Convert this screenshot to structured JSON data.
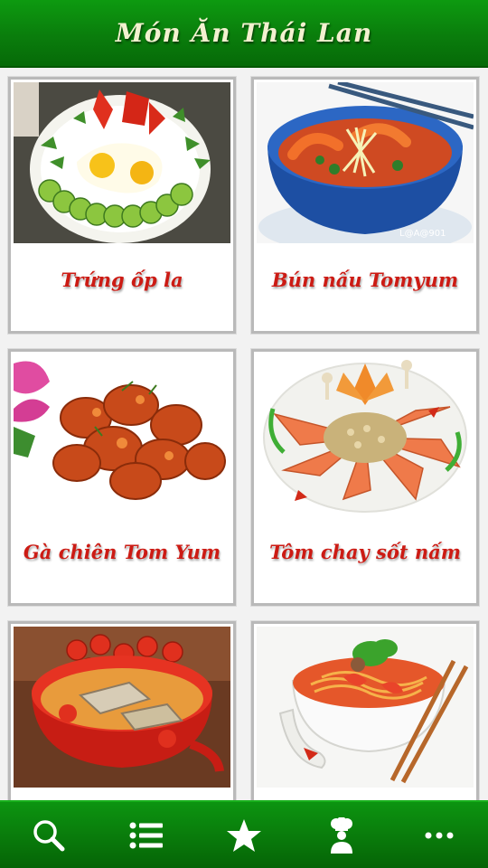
{
  "header": {
    "title": "Món Ăn Thái Lan"
  },
  "dishes": [
    {
      "name": "Trứng ốp la"
    },
    {
      "name": "Bún nấu Tomyum"
    },
    {
      "name": "Gà chiên Tom Yum"
    },
    {
      "name": "Tôm chay sốt nấm"
    },
    {
      "name": ""
    },
    {
      "name": ""
    }
  ],
  "photo_watermarks": {
    "tomyum": "L@A@901"
  },
  "bottom_nav": [
    {
      "icon": "search-icon"
    },
    {
      "icon": "list-icon"
    },
    {
      "icon": "star-icon"
    },
    {
      "icon": "chef-icon"
    },
    {
      "icon": "more-icon"
    }
  ],
  "colors": {
    "header_green": "#0a7d0c",
    "title_text": "#f3f1d0",
    "dish_label_red": "#cc1b14",
    "card_border": "#b9b9b9"
  }
}
